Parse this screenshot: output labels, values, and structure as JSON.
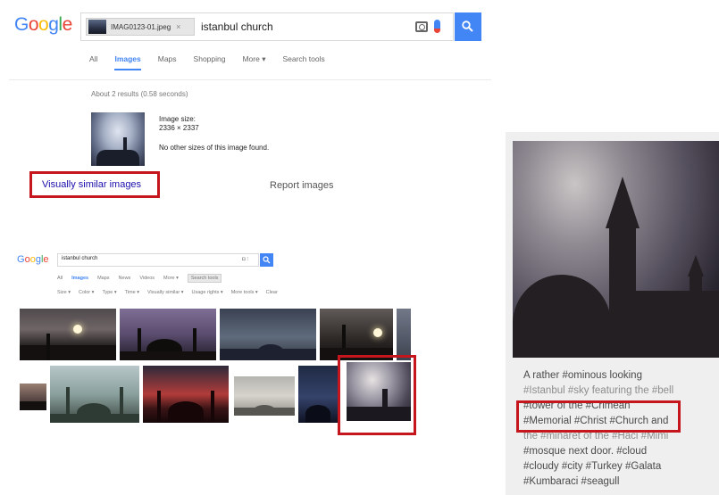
{
  "google": {
    "logo_letters": [
      "G",
      "o",
      "o",
      "g",
      "l",
      "e"
    ],
    "image_chip": {
      "filename": "IMAG0123-01.jpeg",
      "remove": "×"
    },
    "query": "istanbul church",
    "tabs": [
      "All",
      "Images",
      "Maps",
      "Shopping",
      "More ▾",
      "Search tools"
    ],
    "active_tab": "Images",
    "result_stats": "About 2 results (0.58 seconds)",
    "image_size_label": "Image size:",
    "image_size_value": "2336 × 2337",
    "no_other_sizes": "No other sizes of this image found.",
    "visually_similar": "Visually similar images",
    "report_images": "Report images"
  },
  "mini_google": {
    "logo_letters": [
      "G",
      "o",
      "o",
      "g",
      "l",
      "e"
    ],
    "query": "istanbul church",
    "tabs": [
      "All",
      "Images",
      "Maps",
      "News",
      "Videos",
      "More ▾",
      "Search tools"
    ],
    "filters": [
      "Size ▾",
      "Color ▾",
      "Type ▾",
      "Time ▾",
      "Visually similar ▾",
      "Usage rights ▾",
      "More tools ▾",
      "Clear"
    ]
  },
  "post": {
    "caption_lines": [
      "A rather #ominous looking",
      "#Istanbul #sky featuring the #bell",
      "#tower of the #Crimean",
      "#Memorial #Christ #Church and",
      "the #minaret of the #Haci #Mimi",
      "#mosque next door. #cloud",
      "#cloudy #city #Turkey #Galata",
      "#Kumbaraci #seagull"
    ]
  },
  "colors": {
    "google_blue": "#4285f4",
    "google_red": "#ea4335",
    "google_yellow": "#fbbc05",
    "google_green": "#34a853",
    "highlight_red": "#c4161c",
    "link": "#1a0dab"
  },
  "icons": [
    "camera-icon",
    "microphone-icon",
    "search-icon",
    "close-icon"
  ]
}
